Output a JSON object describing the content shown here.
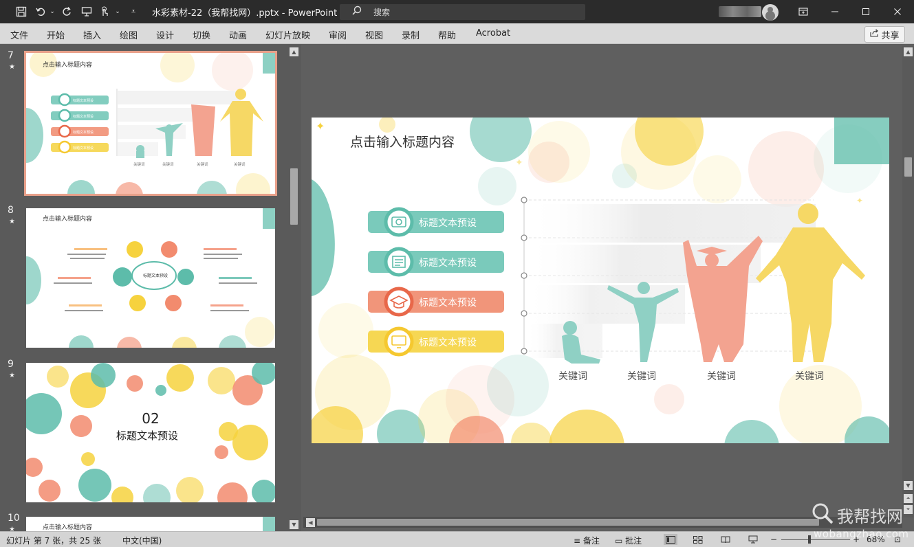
{
  "titlebar": {
    "doc_title": "水彩素材-22（我帮找网）.pptx  -  PowerPoint",
    "search_placeholder": "搜索"
  },
  "menu": {
    "items": [
      "文件",
      "开始",
      "插入",
      "绘图",
      "设计",
      "切换",
      "动画",
      "幻灯片放映",
      "审阅",
      "视图",
      "录制",
      "帮助",
      "Acrobat"
    ],
    "share_label": "共享"
  },
  "thumbnails": [
    {
      "number": "7",
      "title": "点击输入标题内容",
      "keywords": [
        "关键词",
        "关键词",
        "关键词",
        "关键词"
      ],
      "bar_label": "标题文本预设"
    },
    {
      "number": "8",
      "title": "点击输入标题内容",
      "center_label": "标题文本预设"
    },
    {
      "number": "9",
      "big_number": "02",
      "subtitle": "标题文本预设"
    },
    {
      "number": "10",
      "title": "点击输入标题内容"
    }
  ],
  "slide": {
    "title": "点击输入标题内容",
    "bars": [
      {
        "label": "标题文本预设",
        "color": "#6cc4b4",
        "icon": "camera-icon"
      },
      {
        "label": "标题文本预设",
        "color": "#6cc4b4",
        "icon": "newspaper-icon"
      },
      {
        "label": "标题文本预设",
        "color": "#f08a6c",
        "icon": "graduation-cap-icon"
      },
      {
        "label": "标题文本预设",
        "color": "#f5d54a",
        "icon": "monitor-icon"
      }
    ],
    "keywords": [
      "关键词",
      "关键词",
      "关键词",
      "关键词"
    ],
    "colors": {
      "teal": "#5dbcaa",
      "coral": "#f28b6e",
      "yellow": "#f6d23e"
    }
  },
  "status": {
    "slide_info": "幻灯片 第 7 张，共 25 张",
    "language": "中文(中国)",
    "notes": "备注",
    "comments": "批注",
    "zoom": "68%"
  },
  "watermark": {
    "text": "我帮找网",
    "url": "wobangzhao.com"
  }
}
